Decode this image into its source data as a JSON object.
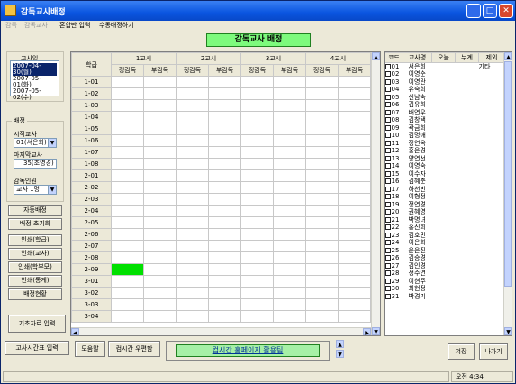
{
  "window": {
    "title": "감독교사배정"
  },
  "menu": [
    {
      "label": "감독",
      "disabled": true
    },
    {
      "label": "감독교사",
      "disabled": true
    },
    {
      "label": "혼합반 입력",
      "disabled": false
    },
    {
      "label": "수동배정하기",
      "disabled": false
    }
  ],
  "header_title": "감독교사 배정",
  "left": {
    "exam_label": "고사일",
    "dates": [
      "2007-04-30(월)",
      "2007-05-01(화)",
      "2007-05-02(수)"
    ],
    "assign_group": "배정",
    "start_teacher_label": "시작교사",
    "start_teacher_value": "01(서은희)",
    "last_teacher_label": "마지막교사",
    "last_teacher_value": "35(조영경)",
    "supervisor_label": "감독인원",
    "supervisor_value": "교사 1명",
    "buttons": [
      "자동배정",
      "배정 초기화",
      "인쇄(학급)",
      "인쇄(교사)",
      "인쇄(학부모)",
      "인쇄(통계)",
      "배정현황"
    ],
    "basic_input_button": "기초자료 입력",
    "exam_time_input_button": "고사시간표 입력"
  },
  "grid": {
    "col_header": "학급",
    "periods": [
      "1교시",
      "2교시",
      "3교시",
      "4교시"
    ],
    "sub_cols": [
      "정감독",
      "부감독"
    ],
    "rows": [
      "1-01",
      "1-02",
      "1-03",
      "1-04",
      "1-05",
      "1-06",
      "1-07",
      "1-08",
      "2-01",
      "2-02",
      "2-03",
      "2-04",
      "2-05",
      "2-06",
      "2-07",
      "2-08",
      "2-09",
      "3-01",
      "3-02",
      "3-03",
      "3-04"
    ],
    "selected_row": "2-09"
  },
  "teacher_list": {
    "headers": [
      "코드",
      "교사명",
      "오늘",
      "누계",
      "제외"
    ],
    "first_row_note": "기타",
    "teachers": [
      {
        "code": "01",
        "name": "서은희"
      },
      {
        "code": "02",
        "name": "이영순"
      },
      {
        "code": "03",
        "name": "이영란"
      },
      {
        "code": "04",
        "name": "유숙희"
      },
      {
        "code": "05",
        "name": "신남숙"
      },
      {
        "code": "06",
        "name": "김유희"
      },
      {
        "code": "07",
        "name": "배연우"
      },
      {
        "code": "08",
        "name": "김창택"
      },
      {
        "code": "09",
        "name": "곽금희"
      },
      {
        "code": "10",
        "name": "김명애"
      },
      {
        "code": "11",
        "name": "정연옥"
      },
      {
        "code": "12",
        "name": "홍은경"
      },
      {
        "code": "13",
        "name": "양연선"
      },
      {
        "code": "14",
        "name": "이영숙"
      },
      {
        "code": "15",
        "name": "이수자"
      },
      {
        "code": "16",
        "name": "김혜춘"
      },
      {
        "code": "17",
        "name": "하선빈"
      },
      {
        "code": "18",
        "name": "이형정"
      },
      {
        "code": "19",
        "name": "정연경"
      },
      {
        "code": "20",
        "name": "권혜영"
      },
      {
        "code": "21",
        "name": "박명녀"
      },
      {
        "code": "22",
        "name": "홍진희"
      },
      {
        "code": "23",
        "name": "김호민"
      },
      {
        "code": "24",
        "name": "이은희"
      },
      {
        "code": "25",
        "name": "윤은진"
      },
      {
        "code": "26",
        "name": "김승경"
      },
      {
        "code": "27",
        "name": "김인경"
      },
      {
        "code": "28",
        "name": "정주연"
      },
      {
        "code": "29",
        "name": "이현주"
      },
      {
        "code": "30",
        "name": "최현정"
      },
      {
        "code": "31",
        "name": "박경기"
      }
    ]
  },
  "bottom": {
    "help_button": "도움말",
    "exam_program_button": "컴시간 우편함",
    "homepage_link": "컴시간 홈페이지 활용팀",
    "save_button": "저장",
    "exit_button": "나가기"
  },
  "status": {
    "time": "오전 4:34"
  }
}
